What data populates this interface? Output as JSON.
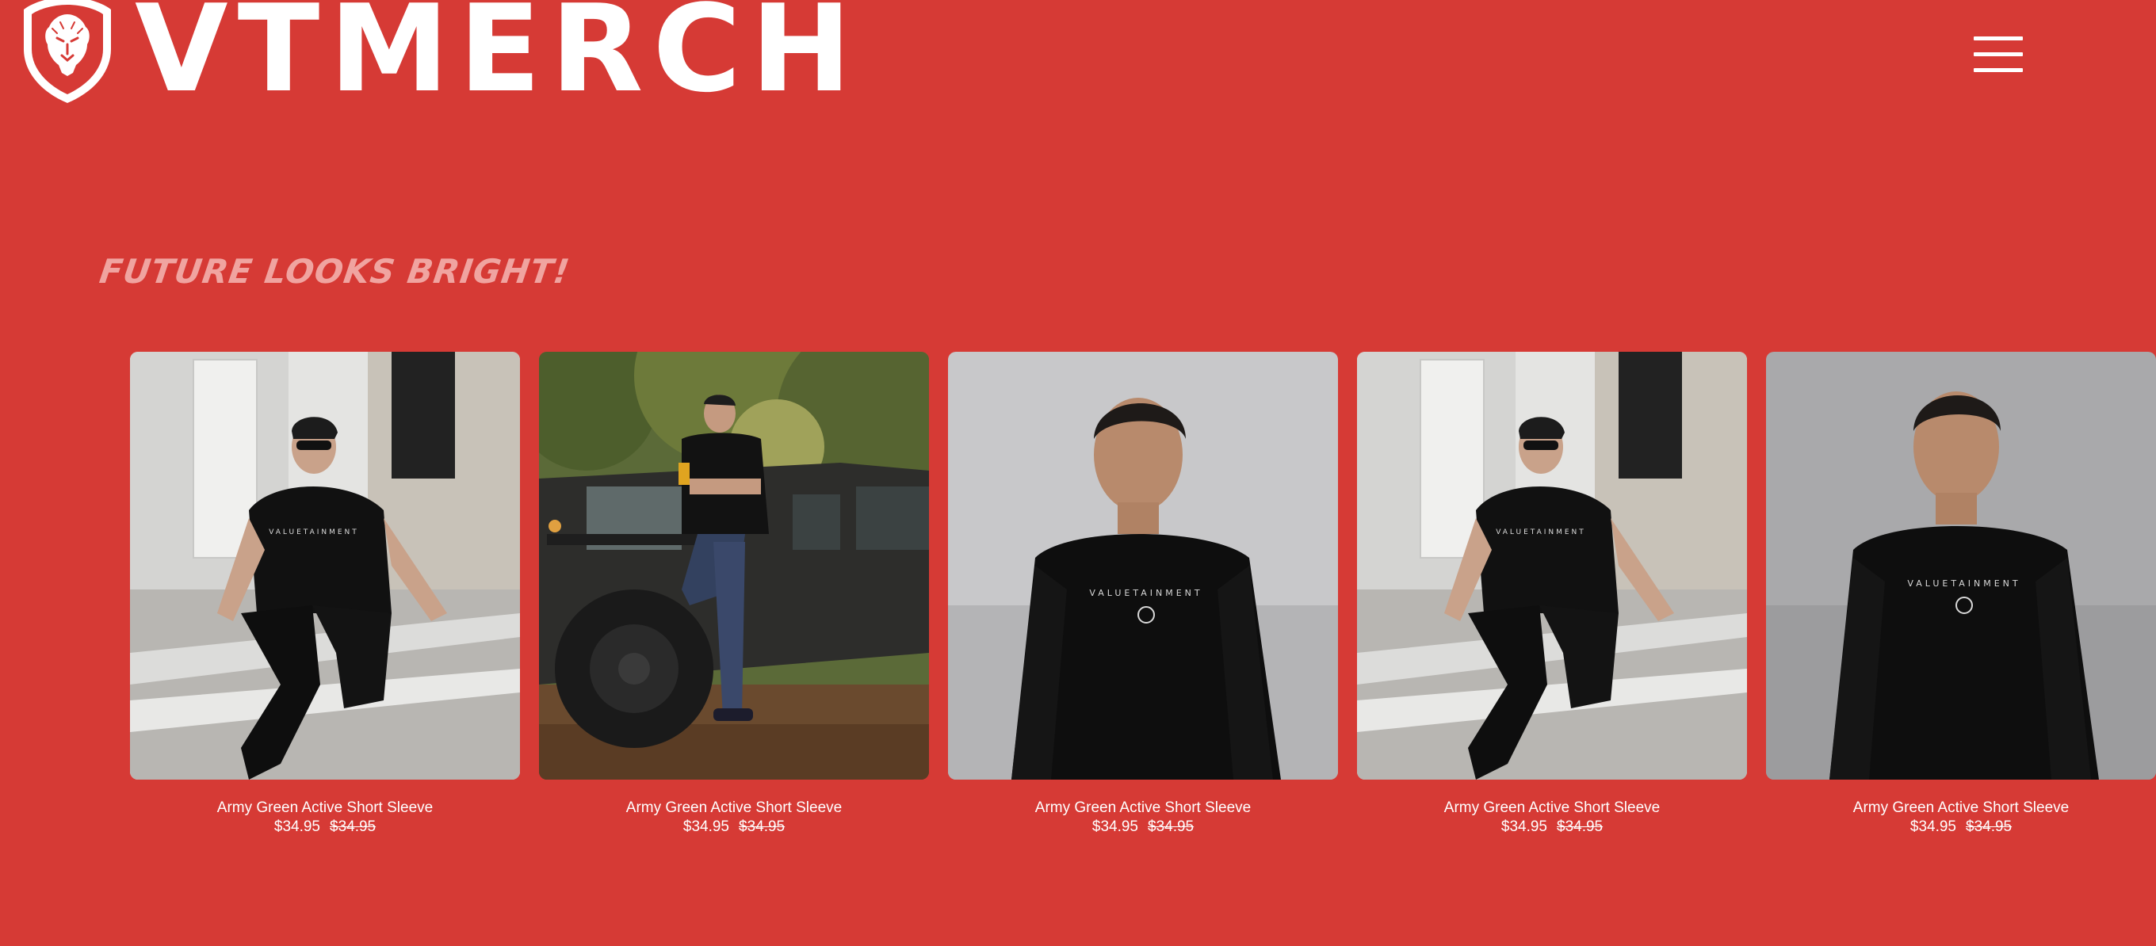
{
  "header": {
    "brand": "VTMERCH"
  },
  "tagline": "FUTURE LOOKS BRIGHT!",
  "colors": {
    "background": "#d63a35",
    "text": "#ffffff",
    "tagline": "#f0a4a0"
  },
  "products": [
    {
      "name": "Army Green Active Short Sleeve",
      "price": "$34.95",
      "compare_price": "$34.95",
      "photo": "man-seated-on-steps-black-tee"
    },
    {
      "name": "Army Green Active Short Sleeve",
      "price": "$34.95",
      "compare_price": "$34.95",
      "photo": "man-leaning-on-black-truck"
    },
    {
      "name": "Army Green Active Short Sleeve",
      "price": "$34.95",
      "compare_price": "$34.95",
      "photo": "man-black-long-sleeve-grey-backdrop"
    },
    {
      "name": "Army Green Active Short Sleeve",
      "price": "$34.95",
      "compare_price": "$34.95",
      "photo": "man-seated-on-steps-black-tee"
    },
    {
      "name": "Army Green Active Short Sleeve",
      "price": "$34.95",
      "compare_price": "$34.95",
      "photo": "man-black-long-sleeve-grey-backdrop"
    }
  ]
}
